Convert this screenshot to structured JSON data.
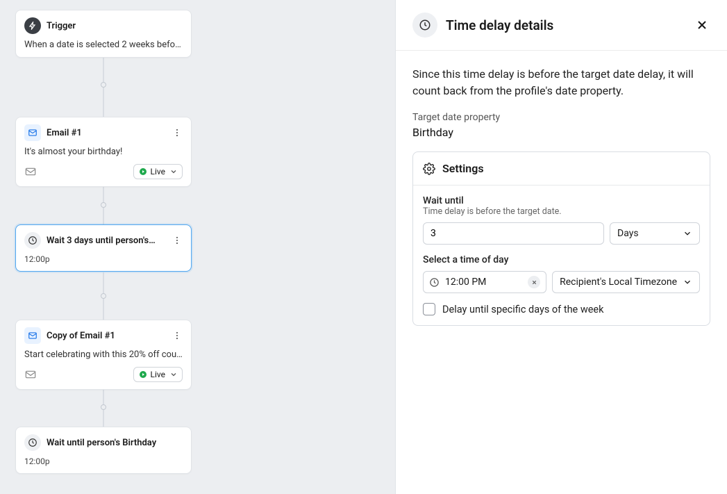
{
  "flow": {
    "trigger": {
      "title": "Trigger",
      "description": "When a date is selected 2 weeks before p…"
    },
    "email1": {
      "title": "Email #1",
      "description": "It's almost your birthday!",
      "status": "Live"
    },
    "wait1": {
      "title": "Wait 3 days until person's…",
      "time": "12:00p"
    },
    "email2": {
      "title": "Copy of Email #1",
      "description": "Start celebrating with this 20% off coupon!",
      "status": "Live"
    },
    "wait2": {
      "title": "Wait until person's Birthday",
      "time": "12:00p"
    }
  },
  "panel": {
    "title": "Time delay details",
    "description": "Since this time delay is before the target date delay, it will count back from the profile's date property.",
    "target_label": "Target date property",
    "target_value": "Birthday",
    "settings": {
      "heading": "Settings",
      "wait_until_label": "Wait until",
      "wait_until_sub": "Time delay is before the target date.",
      "wait_value": "3",
      "wait_unit": "Days",
      "time_label": "Select a time of day",
      "time_value": "12:00 PM",
      "timezone": "Recipient's Local Timezone",
      "checkbox_label": "Delay until specific days of the week"
    }
  }
}
